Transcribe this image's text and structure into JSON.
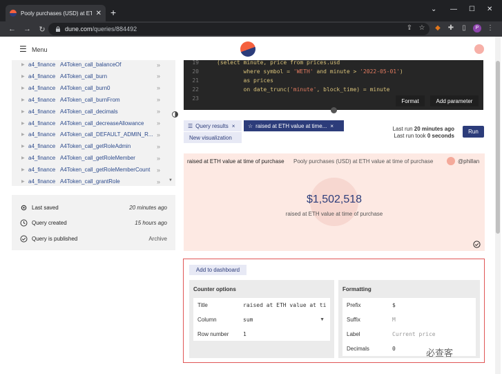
{
  "browser": {
    "tab_title": "Pooly purchases (USD) at ETH va",
    "new_tab": "+",
    "url_host": "dune.com",
    "url_path": "/queries/884492"
  },
  "header": {
    "menu_label": "Menu"
  },
  "sidebar": {
    "tables": [
      {
        "schema": "a4_finance",
        "name": "A4Token_call_balanceOf"
      },
      {
        "schema": "a4_finance",
        "name": "A4Token_call_burn"
      },
      {
        "schema": "a4_finance",
        "name": "A4Token_call_burn0"
      },
      {
        "schema": "a4_finance",
        "name": "A4Token_call_burnFrom"
      },
      {
        "schema": "a4_finance",
        "name": "A4Token_call_decimals"
      },
      {
        "schema": "a4_finance",
        "name": "A4Token_call_decreaseAllowance"
      },
      {
        "schema": "a4_finance",
        "name": "A4Token_call_DEFAULT_ADMIN_R..."
      },
      {
        "schema": "a4_finance",
        "name": "A4Token_call_getRoleAdmin"
      },
      {
        "schema": "a4_finance",
        "name": "A4Token_call_getRoleMember"
      },
      {
        "schema": "a4_finance",
        "name": "A4Token_call_getRoleMemberCount"
      },
      {
        "schema": "a4_finance",
        "name": "A4Token_call_grantRole"
      }
    ],
    "meta": {
      "last_saved_label": "Last saved",
      "last_saved_value": "20 minutes ago",
      "created_label": "Query created",
      "created_value": "15 hours ago",
      "published_label": "Query is published",
      "archive_label": "Archive"
    }
  },
  "editor": {
    "lines": [
      {
        "n": "19",
        "code": "(select minute, price from prices.usd"
      },
      {
        "n": "20",
        "code": "        where symbol = 'WETH' and minute > '2022-05-01')"
      },
      {
        "n": "21",
        "code": "        as prices"
      },
      {
        "n": "22",
        "code": "        on date_trunc('minute', block_time) = minute"
      },
      {
        "n": "23",
        "code": ""
      }
    ],
    "format_label": "Format",
    "add_parameter_label": "Add parameter"
  },
  "tabs": {
    "results_label": "Query results",
    "viz_label": "raised at ETH value at time...",
    "close": "×",
    "new_viz_label": "New visualization"
  },
  "run": {
    "last_run_prefix": "Last run ",
    "last_run_value": "20 minutes ago",
    "took_prefix": "Last run took ",
    "took_value": "0 seconds",
    "run_label": "Run"
  },
  "viz": {
    "title": "raised at ETH value at time of purchase",
    "subtitle": "Pooly purchases (USD) at ETH value at time of purchase",
    "owner": "@phillan",
    "counter_value": "$1,502,518",
    "counter_label": "raised at ETH value at time of purchase"
  },
  "settings": {
    "add_dashboard_label": "Add to dashboard",
    "counter_options": {
      "heading": "Counter options",
      "title_label": "Title",
      "title_value": "raised at ETH value at tim",
      "column_label": "Column",
      "column_value": "sum",
      "row_label": "Row number",
      "row_value": "1"
    },
    "formatting": {
      "heading": "Formatting",
      "prefix_label": "Prefix",
      "prefix_value": "$",
      "suffix_label": "Suffix",
      "suffix_placeholder": "M",
      "label_label": "Label",
      "label_placeholder": "Current price",
      "decimals_label": "Decimals",
      "decimals_value": "0"
    }
  },
  "watermark": "必查客"
}
